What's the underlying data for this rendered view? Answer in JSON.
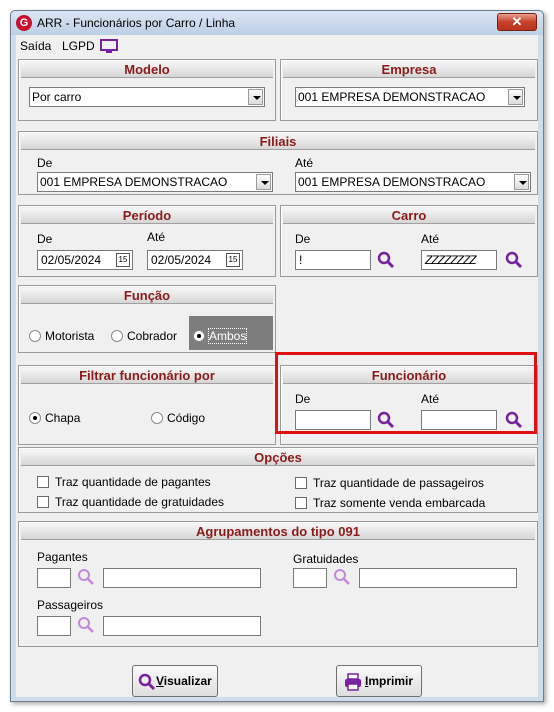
{
  "window": {
    "title": "ARR - Funcionários por Carro / Linha",
    "close_glyph": "✕",
    "app_icon_glyph": "G"
  },
  "menu": {
    "saida": "Saída",
    "lgpd": "LGPD"
  },
  "modelo": {
    "header": "Modelo",
    "value": "Por carro"
  },
  "empresa": {
    "header": "Empresa",
    "value": "001 EMPRESA DEMONSTRACAO"
  },
  "filiais": {
    "header": "Filiais",
    "de_label": "De",
    "de_value": "001 EMPRESA DEMONSTRACAO",
    "ate_label": "Até",
    "ate_value": "001 EMPRESA DEMONSTRACAO"
  },
  "periodo": {
    "header": "Período",
    "de_label": "De",
    "de_value": "02/05/2024",
    "ate_label": "Até",
    "ate_value": "02/05/2024",
    "cal_glyph": "15"
  },
  "carro": {
    "header": "Carro",
    "de_label": "De",
    "de_value": "!",
    "ate_label": "Até",
    "ate_value": "ZZZZZZZZ"
  },
  "funcao": {
    "header": "Função",
    "options": [
      "Motorista",
      "Cobrador",
      "Ambos"
    ],
    "selected": "Ambos"
  },
  "filtrar": {
    "header": "Filtrar funcionário por",
    "options": [
      "Chapa",
      "Código"
    ],
    "selected": "Chapa"
  },
  "funcionario": {
    "header": "Funcionário",
    "de_label": "De",
    "de_value": "",
    "ate_label": "Até",
    "ate_value": ""
  },
  "opcoes": {
    "header": "Opções",
    "items": [
      "Traz quantidade de pagantes",
      "Traz quantidade de gratuidades",
      "Traz quantidade de passageiros",
      "Traz somente venda embarcada"
    ]
  },
  "agrupamentos": {
    "header": "Agrupamentos do tipo 091",
    "pagantes_label": "Pagantes",
    "gratuidades_label": "Gratuidades",
    "passageiros_label": "Passageiros"
  },
  "buttons": {
    "visualizar": "Visualizar",
    "imprimir": "Imprimir"
  },
  "colors": {
    "header_text": "#8b1a1a",
    "highlight": "#e01010",
    "icon_purple": "#7a1fa2"
  }
}
